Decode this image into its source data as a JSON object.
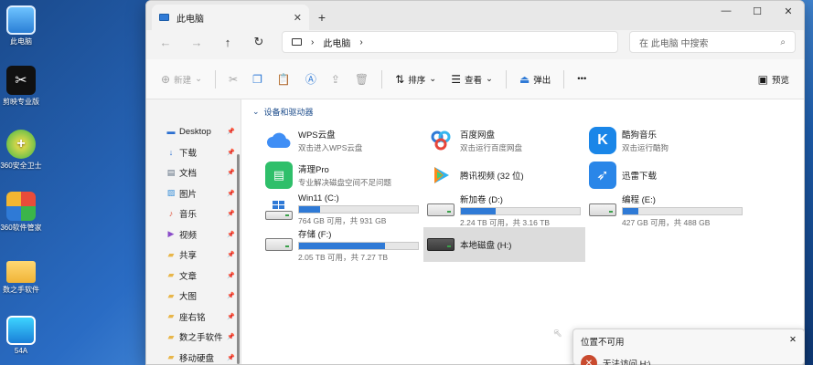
{
  "desktop": {
    "icons": [
      {
        "label": "此电脑"
      },
      {
        "label": "剪映专业版"
      },
      {
        "label": "360安全卫士"
      },
      {
        "label": "360软件管家"
      },
      {
        "label": "数之手软件"
      },
      {
        "label": "54A"
      }
    ]
  },
  "window": {
    "tab_title": "此电脑",
    "tab_close": "✕",
    "new_tab": "+",
    "controls": {
      "minimize": "—",
      "maximize": "☐",
      "close": "✕"
    },
    "path_label": "此电脑",
    "path_chevron": "›",
    "search_placeholder": "在 此电脑 中搜索"
  },
  "toolbar": {
    "new": "新建",
    "sort": "排序",
    "view": "查看",
    "eject": "弹出",
    "more": "•••",
    "preview": "预览"
  },
  "sidebar": {
    "items": [
      {
        "label": "Desktop",
        "icon": "desktop-icon",
        "color": "#2b6fd0"
      },
      {
        "label": "下载",
        "icon": "download-icon",
        "color": "#2b6fd0"
      },
      {
        "label": "文档",
        "icon": "document-icon",
        "color": "#5a6b7d"
      },
      {
        "label": "图片",
        "icon": "pictures-icon",
        "color": "#3a8fd8"
      },
      {
        "label": "音乐",
        "icon": "music-icon",
        "color": "#e0533c"
      },
      {
        "label": "视频",
        "icon": "video-icon",
        "color": "#8a4cc9"
      },
      {
        "label": "共享",
        "icon": "folder-icon",
        "color": "#e8b64a"
      },
      {
        "label": "文章",
        "icon": "folder-icon",
        "color": "#e8b64a"
      },
      {
        "label": "大图",
        "icon": "folder-icon",
        "color": "#e8b64a"
      },
      {
        "label": "座右铭",
        "icon": "folder-icon",
        "color": "#e8b64a"
      },
      {
        "label": "数之手软件",
        "icon": "folder-icon",
        "color": "#e8b64a"
      },
      {
        "label": "移动硬盘",
        "icon": "folder-icon",
        "color": "#e8b64a"
      }
    ]
  },
  "main": {
    "section_title": "设备和驱动器",
    "apps": [
      {
        "name": "WPS云盘",
        "sub": "双击进入WPS云盘",
        "icon": "cloud-icon"
      },
      {
        "name": "百度网盘",
        "sub": "双击运行百度网盘",
        "icon": "baidu-netdisk-icon"
      },
      {
        "name": "酷狗音乐",
        "sub": "双击运行酷狗",
        "icon": "kugou-icon"
      },
      {
        "name": "清理Pro",
        "sub": "专业解决磁盘空间不足问题",
        "icon": "cleaner-pro-icon"
      },
      {
        "name": "腾讯视频 (32 位)",
        "sub": "",
        "icon": "tencent-video-icon"
      },
      {
        "name": "迅雷下载",
        "sub": "",
        "icon": "xunlei-icon"
      }
    ],
    "drives": [
      {
        "name": "Win11 (C:)",
        "sub": "764 GB 可用，共 931 GB",
        "fill": 0.18,
        "color": "#2f7ad6"
      },
      {
        "name": "新加卷 (D:)",
        "sub": "2.24 TB 可用，共 3.16 TB",
        "fill": 0.29,
        "color": "#2f7ad6"
      },
      {
        "name": "编程 (E:)",
        "sub": "427 GB 可用，共 488 GB",
        "fill": 0.13,
        "color": "#2f7ad6"
      },
      {
        "name": "存储 (F:)",
        "sub": "2.05 TB 可用，共 7.27 TB",
        "fill": 0.72,
        "color": "#2f7ad6"
      },
      {
        "name": "本地磁盘 (H:)",
        "sub": "",
        "fill": null,
        "color": "#2f7ad6"
      }
    ]
  },
  "notification": {
    "title": "位置不可用",
    "close": "✕",
    "message": "无法访问 H:\\"
  }
}
